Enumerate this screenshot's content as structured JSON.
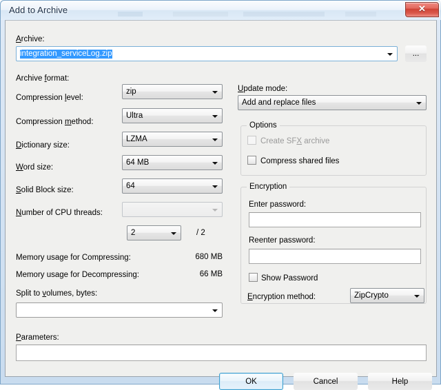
{
  "window": {
    "title": "Add to Archive",
    "close_label": "✕"
  },
  "archive": {
    "label": "Archive:",
    "label_mnemonic": "A",
    "value": "integration_serviceLog.zip",
    "selected": true,
    "browse_label": "..."
  },
  "left_column": {
    "archive_format": {
      "label": "Archive format:",
      "value": "zip"
    },
    "compression_level": {
      "label": "Compression level:",
      "value": "Ultra"
    },
    "compression_method": {
      "label": "Compression method:",
      "value": "LZMA"
    },
    "dictionary_size": {
      "label": "Dictionary size:",
      "value": "64 MB"
    },
    "word_size": {
      "label": "Word size:",
      "value": "64"
    },
    "solid_block_size": {
      "label": "Solid Block size:",
      "value": "",
      "disabled": true
    },
    "cpu_threads": {
      "label": "Number of CPU threads:",
      "value": "2",
      "suffix": "/ 2"
    },
    "memory_compress": {
      "label": "Memory usage for Compressing:",
      "value": "680 MB"
    },
    "memory_decompress": {
      "label": "Memory usage for Decompressing:",
      "value": "66 MB"
    },
    "split_volumes": {
      "label": "Split to volumes, bytes:",
      "value": ""
    }
  },
  "right_column": {
    "update_mode": {
      "label": "Update mode:",
      "value": "Add and replace files"
    },
    "options": {
      "title": "Options",
      "create_sfx": {
        "label": "Create SFX archive",
        "checked": false,
        "disabled": true
      },
      "compress_shared": {
        "label": "Compress shared files",
        "checked": false,
        "disabled": false
      }
    },
    "encryption": {
      "title": "Encryption",
      "enter_password": {
        "label": "Enter password:",
        "value": ""
      },
      "reenter_password": {
        "label": "Reenter password:",
        "value": ""
      },
      "show_password": {
        "label": "Show Password",
        "checked": false
      },
      "encryption_method": {
        "label": "Encryption method:",
        "value": "ZipCrypto"
      }
    }
  },
  "parameters": {
    "label": "Parameters:",
    "value": ""
  },
  "buttons": {
    "ok": "OK",
    "cancel": "Cancel",
    "help": "Help"
  }
}
